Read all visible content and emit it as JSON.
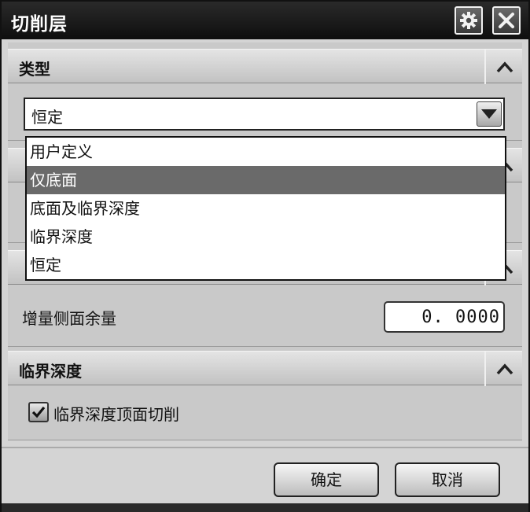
{
  "window": {
    "title": "切削层"
  },
  "sections": {
    "type": {
      "title": "类型",
      "select_value": "恒定"
    },
    "options": {
      "stock_label": "增量侧面余量",
      "stock_value": "0. 0000"
    },
    "critical_depth": {
      "title": "临界深度",
      "checkbox_label": "临界深度顶面切削",
      "checkbox_checked": true
    }
  },
  "dropdown": {
    "options": [
      {
        "label": "用户定义"
      },
      {
        "label": "仅底面"
      },
      {
        "label": "底面及临界深度"
      },
      {
        "label": "临界深度"
      },
      {
        "label": "恒定"
      }
    ],
    "selected_index": 1
  },
  "footer": {
    "ok_label": "确定",
    "cancel_label": "取消"
  },
  "icons": {
    "gear": "gear-icon",
    "close": "close-icon",
    "collapse": "chevron-up-icon",
    "dropdown_arrow": "chevron-down-icon",
    "check": "check-icon"
  }
}
